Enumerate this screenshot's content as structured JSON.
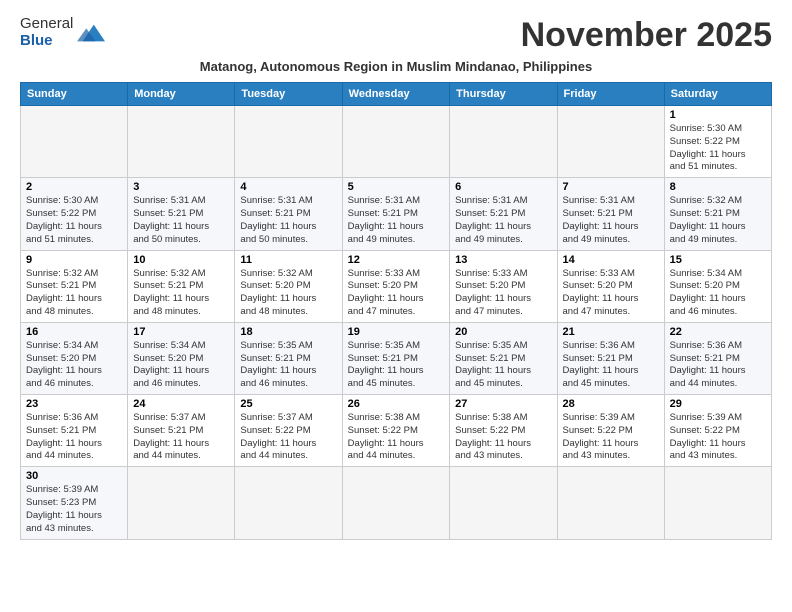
{
  "header": {
    "logo": {
      "general": "General",
      "blue": "Blue"
    },
    "month_title": "November 2025",
    "subtitle": "Matanog, Autonomous Region in Muslim Mindanao, Philippines"
  },
  "days_of_week": [
    "Sunday",
    "Monday",
    "Tuesday",
    "Wednesday",
    "Thursday",
    "Friday",
    "Saturday"
  ],
  "weeks": [
    [
      {
        "day": "",
        "info": ""
      },
      {
        "day": "",
        "info": ""
      },
      {
        "day": "",
        "info": ""
      },
      {
        "day": "",
        "info": ""
      },
      {
        "day": "",
        "info": ""
      },
      {
        "day": "",
        "info": ""
      },
      {
        "day": "1",
        "info": "Sunrise: 5:30 AM\nSunset: 5:22 PM\nDaylight: 11 hours\nand 51 minutes."
      }
    ],
    [
      {
        "day": "2",
        "info": "Sunrise: 5:30 AM\nSunset: 5:22 PM\nDaylight: 11 hours\nand 51 minutes."
      },
      {
        "day": "3",
        "info": "Sunrise: 5:31 AM\nSunset: 5:21 PM\nDaylight: 11 hours\nand 50 minutes."
      },
      {
        "day": "4",
        "info": "Sunrise: 5:31 AM\nSunset: 5:21 PM\nDaylight: 11 hours\nand 50 minutes."
      },
      {
        "day": "5",
        "info": "Sunrise: 5:31 AM\nSunset: 5:21 PM\nDaylight: 11 hours\nand 49 minutes."
      },
      {
        "day": "6",
        "info": "Sunrise: 5:31 AM\nSunset: 5:21 PM\nDaylight: 11 hours\nand 49 minutes."
      },
      {
        "day": "7",
        "info": "Sunrise: 5:31 AM\nSunset: 5:21 PM\nDaylight: 11 hours\nand 49 minutes."
      },
      {
        "day": "8",
        "info": "Sunrise: 5:32 AM\nSunset: 5:21 PM\nDaylight: 11 hours\nand 49 minutes."
      }
    ],
    [
      {
        "day": "9",
        "info": "Sunrise: 5:32 AM\nSunset: 5:21 PM\nDaylight: 11 hours\nand 48 minutes."
      },
      {
        "day": "10",
        "info": "Sunrise: 5:32 AM\nSunset: 5:21 PM\nDaylight: 11 hours\nand 48 minutes."
      },
      {
        "day": "11",
        "info": "Sunrise: 5:32 AM\nSunset: 5:20 PM\nDaylight: 11 hours\nand 48 minutes."
      },
      {
        "day": "12",
        "info": "Sunrise: 5:33 AM\nSunset: 5:20 PM\nDaylight: 11 hours\nand 47 minutes."
      },
      {
        "day": "13",
        "info": "Sunrise: 5:33 AM\nSunset: 5:20 PM\nDaylight: 11 hours\nand 47 minutes."
      },
      {
        "day": "14",
        "info": "Sunrise: 5:33 AM\nSunset: 5:20 PM\nDaylight: 11 hours\nand 47 minutes."
      },
      {
        "day": "15",
        "info": "Sunrise: 5:34 AM\nSunset: 5:20 PM\nDaylight: 11 hours\nand 46 minutes."
      }
    ],
    [
      {
        "day": "16",
        "info": "Sunrise: 5:34 AM\nSunset: 5:20 PM\nDaylight: 11 hours\nand 46 minutes."
      },
      {
        "day": "17",
        "info": "Sunrise: 5:34 AM\nSunset: 5:20 PM\nDaylight: 11 hours\nand 46 minutes."
      },
      {
        "day": "18",
        "info": "Sunrise: 5:35 AM\nSunset: 5:21 PM\nDaylight: 11 hours\nand 46 minutes."
      },
      {
        "day": "19",
        "info": "Sunrise: 5:35 AM\nSunset: 5:21 PM\nDaylight: 11 hours\nand 45 minutes."
      },
      {
        "day": "20",
        "info": "Sunrise: 5:35 AM\nSunset: 5:21 PM\nDaylight: 11 hours\nand 45 minutes."
      },
      {
        "day": "21",
        "info": "Sunrise: 5:36 AM\nSunset: 5:21 PM\nDaylight: 11 hours\nand 45 minutes."
      },
      {
        "day": "22",
        "info": "Sunrise: 5:36 AM\nSunset: 5:21 PM\nDaylight: 11 hours\nand 44 minutes."
      }
    ],
    [
      {
        "day": "23",
        "info": "Sunrise: 5:36 AM\nSunset: 5:21 PM\nDaylight: 11 hours\nand 44 minutes."
      },
      {
        "day": "24",
        "info": "Sunrise: 5:37 AM\nSunset: 5:21 PM\nDaylight: 11 hours\nand 44 minutes."
      },
      {
        "day": "25",
        "info": "Sunrise: 5:37 AM\nSunset: 5:22 PM\nDaylight: 11 hours\nand 44 minutes."
      },
      {
        "day": "26",
        "info": "Sunrise: 5:38 AM\nSunset: 5:22 PM\nDaylight: 11 hours\nand 44 minutes."
      },
      {
        "day": "27",
        "info": "Sunrise: 5:38 AM\nSunset: 5:22 PM\nDaylight: 11 hours\nand 43 minutes."
      },
      {
        "day": "28",
        "info": "Sunrise: 5:39 AM\nSunset: 5:22 PM\nDaylight: 11 hours\nand 43 minutes."
      },
      {
        "day": "29",
        "info": "Sunrise: 5:39 AM\nSunset: 5:22 PM\nDaylight: 11 hours\nand 43 minutes."
      }
    ],
    [
      {
        "day": "30",
        "info": "Sunrise: 5:39 AM\nSunset: 5:23 PM\nDaylight: 11 hours\nand 43 minutes."
      },
      {
        "day": "",
        "info": ""
      },
      {
        "day": "",
        "info": ""
      },
      {
        "day": "",
        "info": ""
      },
      {
        "day": "",
        "info": ""
      },
      {
        "day": "",
        "info": ""
      },
      {
        "day": "",
        "info": ""
      }
    ]
  ]
}
